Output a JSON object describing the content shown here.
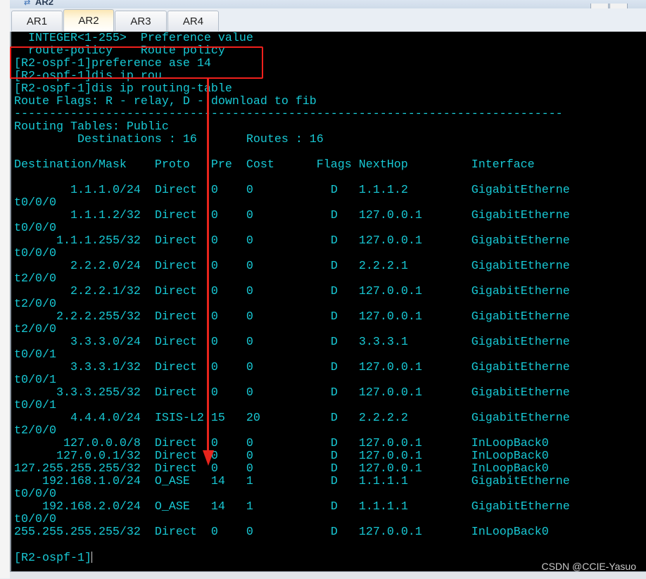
{
  "window": {
    "title": "AR2",
    "icon": "huawei-ensp-icon"
  },
  "tabs": [
    {
      "label": "AR1",
      "active": false
    },
    {
      "label": "AR2",
      "active": true
    },
    {
      "label": "AR3",
      "active": false
    },
    {
      "label": "AR4",
      "active": false
    }
  ],
  "terminal": {
    "text_color": "#18c8d4",
    "header_lines": [
      "  INTEGER<1-255>  Preference value",
      "  route-policy    Route policy",
      "[R2-ospf-1]preference ase 14",
      "[R2-ospf-1]dis ip rou",
      "[R2-ospf-1]dis ip routing-table",
      "Route Flags: R - relay, D - download to fib",
      "------------------------------------------------------------------------------",
      "Routing Tables: Public",
      "         Destinations : 16       Routes : 16",
      "",
      "Destination/Mask    Proto   Pre  Cost      Flags NextHop         Interface",
      ""
    ],
    "routes": [
      {
        "dest": "1.1.1.0/24",
        "proto": "Direct",
        "pre": "0",
        "cost": "0",
        "flags": "D",
        "nexthop": "1.1.1.2",
        "iface": "GigabitEthernet0/0/0"
      },
      {
        "dest": "1.1.1.2/32",
        "proto": "Direct",
        "pre": "0",
        "cost": "0",
        "flags": "D",
        "nexthop": "127.0.0.1",
        "iface": "GigabitEthernet0/0/0"
      },
      {
        "dest": "1.1.1.255/32",
        "proto": "Direct",
        "pre": "0",
        "cost": "0",
        "flags": "D",
        "nexthop": "127.0.0.1",
        "iface": "GigabitEthernet0/0/0"
      },
      {
        "dest": "2.2.2.0/24",
        "proto": "Direct",
        "pre": "0",
        "cost": "0",
        "flags": "D",
        "nexthop": "2.2.2.1",
        "iface": "GigabitEthernet2/0/0"
      },
      {
        "dest": "2.2.2.1/32",
        "proto": "Direct",
        "pre": "0",
        "cost": "0",
        "flags": "D",
        "nexthop": "127.0.0.1",
        "iface": "GigabitEthernet2/0/0"
      },
      {
        "dest": "2.2.2.255/32",
        "proto": "Direct",
        "pre": "0",
        "cost": "0",
        "flags": "D",
        "nexthop": "127.0.0.1",
        "iface": "GigabitEthernet2/0/0"
      },
      {
        "dest": "3.3.3.0/24",
        "proto": "Direct",
        "pre": "0",
        "cost": "0",
        "flags": "D",
        "nexthop": "3.3.3.1",
        "iface": "GigabitEthernet0/0/1"
      },
      {
        "dest": "3.3.3.1/32",
        "proto": "Direct",
        "pre": "0",
        "cost": "0",
        "flags": "D",
        "nexthop": "127.0.0.1",
        "iface": "GigabitEthernet0/0/1"
      },
      {
        "dest": "3.3.3.255/32",
        "proto": "Direct",
        "pre": "0",
        "cost": "0",
        "flags": "D",
        "nexthop": "127.0.0.1",
        "iface": "GigabitEthernet0/0/1"
      },
      {
        "dest": "4.4.4.0/24",
        "proto": "ISIS-L2",
        "pre": "15",
        "cost": "20",
        "flags": "D",
        "nexthop": "2.2.2.2",
        "iface": "GigabitEthernet2/0/0"
      },
      {
        "dest": "127.0.0.0/8",
        "proto": "Direct",
        "pre": "0",
        "cost": "0",
        "flags": "D",
        "nexthop": "127.0.0.1",
        "iface": "InLoopBack0"
      },
      {
        "dest": "127.0.0.1/32",
        "proto": "Direct",
        "pre": "0",
        "cost": "0",
        "flags": "D",
        "nexthop": "127.0.0.1",
        "iface": "InLoopBack0"
      },
      {
        "dest": "127.255.255.255/32",
        "proto": "Direct",
        "pre": "0",
        "cost": "0",
        "flags": "D",
        "nexthop": "127.0.0.1",
        "iface": "InLoopBack0"
      },
      {
        "dest": "192.168.1.0/24",
        "proto": "O_ASE",
        "pre": "14",
        "cost": "1",
        "flags": "D",
        "nexthop": "1.1.1.1",
        "iface": "GigabitEthernet0/0/0"
      },
      {
        "dest": "192.168.2.0/24",
        "proto": "O_ASE",
        "pre": "14",
        "cost": "1",
        "flags": "D",
        "nexthop": "1.1.1.1",
        "iface": "GigabitEthernet0/0/0"
      },
      {
        "dest": "255.255.255.255/32",
        "proto": "Direct",
        "pre": "0",
        "cost": "0",
        "flags": "D",
        "nexthop": "127.0.0.1",
        "iface": "InLoopBack0"
      }
    ],
    "prompt": "[R2-ospf-1]"
  },
  "annotation": {
    "color": "#e8241c"
  },
  "watermark": "CSDN @CCIE-Yasuo"
}
